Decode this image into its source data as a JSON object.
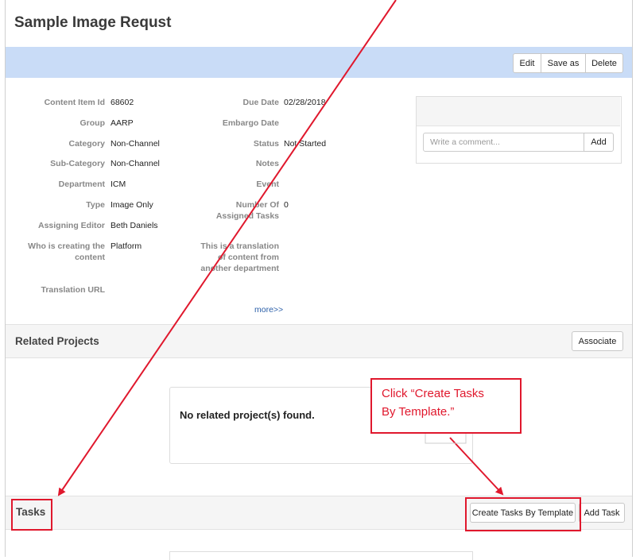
{
  "page": {
    "title": "Sample Image Requst"
  },
  "toolbar": {
    "edit_label": "Edit",
    "save_as_label": "Save as",
    "delete_label": "Delete"
  },
  "details_left": [
    {
      "label": "Content Item Id",
      "value": "68602"
    },
    {
      "label": "Group",
      "value": "AARP"
    },
    {
      "label": "Category",
      "value": "Non-Channel"
    },
    {
      "label": "Sub-Category",
      "value": "Non-Channel"
    },
    {
      "label": "Department",
      "value": "ICM"
    },
    {
      "label": "Type",
      "value": "Image Only"
    },
    {
      "label": "Assigning Editor",
      "value": "Beth Daniels"
    },
    {
      "label": "Who is creating the content",
      "value": "Platform"
    },
    {
      "label": "Translation URL",
      "value": ""
    }
  ],
  "details_right": [
    {
      "label": "Due Date",
      "value": "02/28/2018"
    },
    {
      "label": "Embargo Date",
      "value": ""
    },
    {
      "label": "Status",
      "value": "Not Started"
    },
    {
      "label": "Notes",
      "value": ""
    },
    {
      "label": "Event",
      "value": ""
    },
    {
      "label": "Number Of Assigned Tasks",
      "value": "0"
    },
    {
      "label": "This is a translation of content from another department",
      "value": ""
    }
  ],
  "comments": {
    "placeholder": "Write a comment...",
    "add_label": "Add"
  },
  "more_link": "more>>",
  "related_projects": {
    "title": "Related Projects",
    "associate_label": "Associate",
    "empty_text": "No related project(s) found."
  },
  "tasks": {
    "title": "Tasks",
    "create_by_template_label": "Create Tasks By Template",
    "add_task_label": "Add Task"
  },
  "annotation": {
    "callout_line1": "Click “Create Tasks",
    "callout_line2": "By Template.”",
    "color": "#e0182d"
  }
}
